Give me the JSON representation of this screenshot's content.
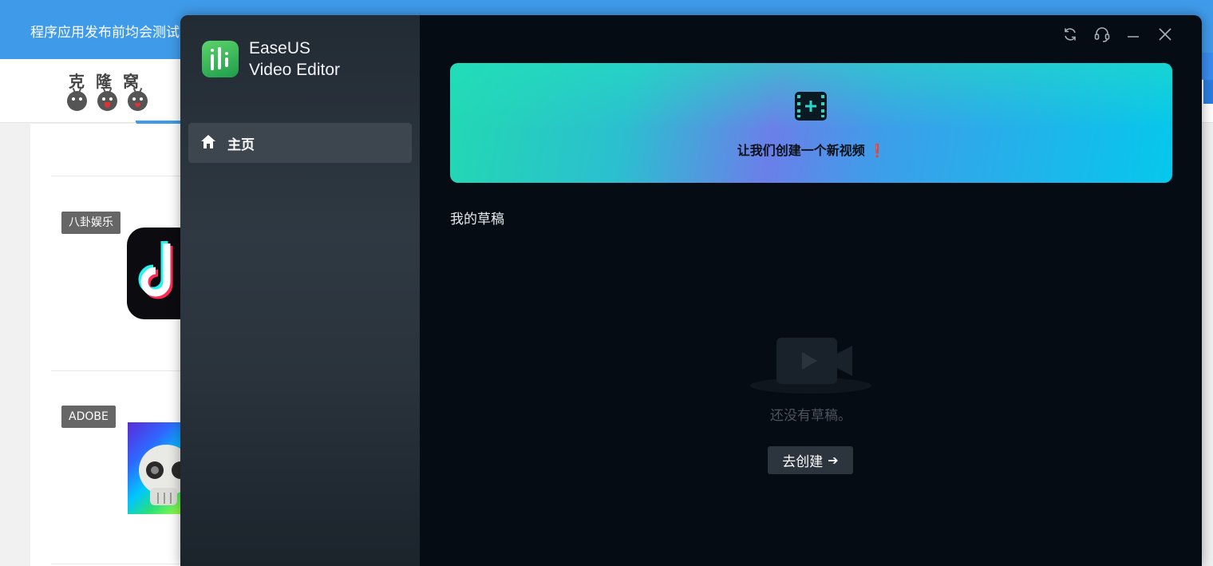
{
  "background_page": {
    "topbar_text": "程序应用发布前均会测试",
    "site_logo_text": "克隆窝",
    "tags": [
      "八卦娱乐",
      "ADOBE"
    ]
  },
  "app": {
    "brand_line1": "EaseUS",
    "brand_line2": "Video Editor",
    "nav": {
      "home_label": "主页"
    },
    "window_controls": [
      "refresh-icon",
      "support-headset-icon",
      "minimize-icon",
      "close-icon"
    ],
    "banner": {
      "text": "让我们创建一个新视频 ❗",
      "icon": "film-add-icon"
    },
    "drafts": {
      "title": "我的草稿",
      "empty_text": "还没有草稿。",
      "create_label": "去创建"
    }
  },
  "colors": {
    "accent_blue": "#3f9bea",
    "app_bg": "#060c14",
    "sidebar_active": "#3d464f",
    "banner_start": "#22d9b1",
    "banner_end": "#05c8ec"
  }
}
